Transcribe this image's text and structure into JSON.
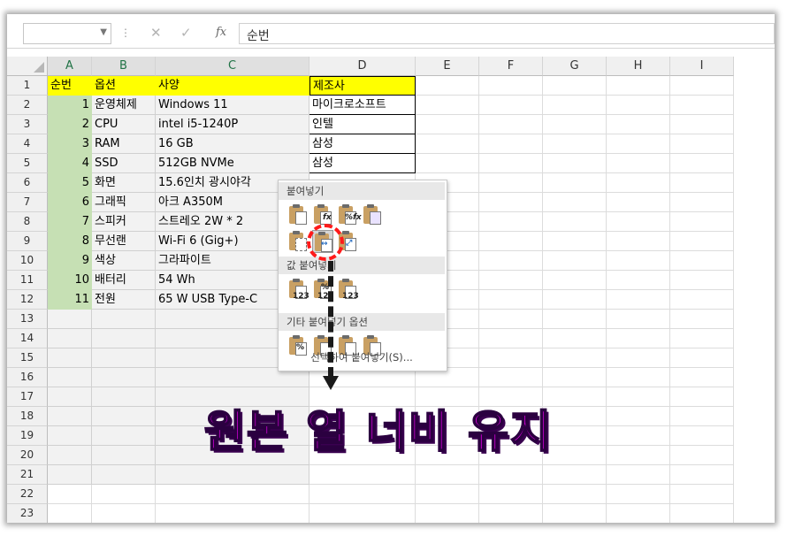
{
  "formula_bar": {
    "name_box": "",
    "cancel": "✕",
    "enter": "✓",
    "fx": "fx",
    "content": "순번"
  },
  "columns": [
    "A",
    "B",
    "C",
    "D",
    "E",
    "F",
    "G",
    "H",
    "I"
  ],
  "rows": [
    "1",
    "2",
    "3",
    "4",
    "5",
    "6",
    "7",
    "8",
    "9",
    "10",
    "11",
    "12",
    "13",
    "14",
    "15",
    "16",
    "17",
    "18",
    "19",
    "20",
    "21",
    "22",
    "23"
  ],
  "table": {
    "headers": [
      "순번",
      "옵션",
      "사양",
      "제조사"
    ],
    "data": [
      {
        "num": "1",
        "option": "운영체제",
        "spec": "Windows 11",
        "maker": "마이크로소프트"
      },
      {
        "num": "2",
        "option": "CPU",
        "spec": "intel i5-1240P",
        "maker": "인텔"
      },
      {
        "num": "3",
        "option": "RAM",
        "spec": "16 GB",
        "maker": "삼성"
      },
      {
        "num": "4",
        "option": "SSD",
        "spec": "512GB NVMe",
        "maker": "삼성"
      },
      {
        "num": "5",
        "option": "화면",
        "spec": "15.6인치 광시야각",
        "maker": ""
      },
      {
        "num": "6",
        "option": "그래픽",
        "spec": "아크 A350M",
        "maker": ""
      },
      {
        "num": "7",
        "option": "스피커",
        "spec": "스트레오 2W * 2",
        "maker": ""
      },
      {
        "num": "8",
        "option": "무선랜",
        "spec": "Wi-Fi 6 (Gig+)",
        "maker": ""
      },
      {
        "num": "9",
        "option": "색상",
        "spec": "그라파이트",
        "maker": ""
      },
      {
        "num": "10",
        "option": "배터리",
        "spec": "54 Wh",
        "maker": ""
      },
      {
        "num": "11",
        "option": "전원",
        "spec": "65 W USB Type-C",
        "maker": ""
      }
    ]
  },
  "paste_menu": {
    "section_paste": "붙여넣기",
    "section_values": "값 붙여넣기",
    "section_other": "기타 붙여넣기 옵션",
    "paste_special": "선택하여 붙여넣기(S)...",
    "badges": {
      "formula": "fx",
      "percent_fx": "%fx",
      "values": "123",
      "percent": "%"
    }
  },
  "annotation": {
    "caption": "원본 열 너비 유지",
    "ring_color": "#ff1a1a",
    "caption_color": "#ff00ff"
  },
  "colors": {
    "header_fill": "#ffff00",
    "number_fill": "#c6e0b4"
  }
}
